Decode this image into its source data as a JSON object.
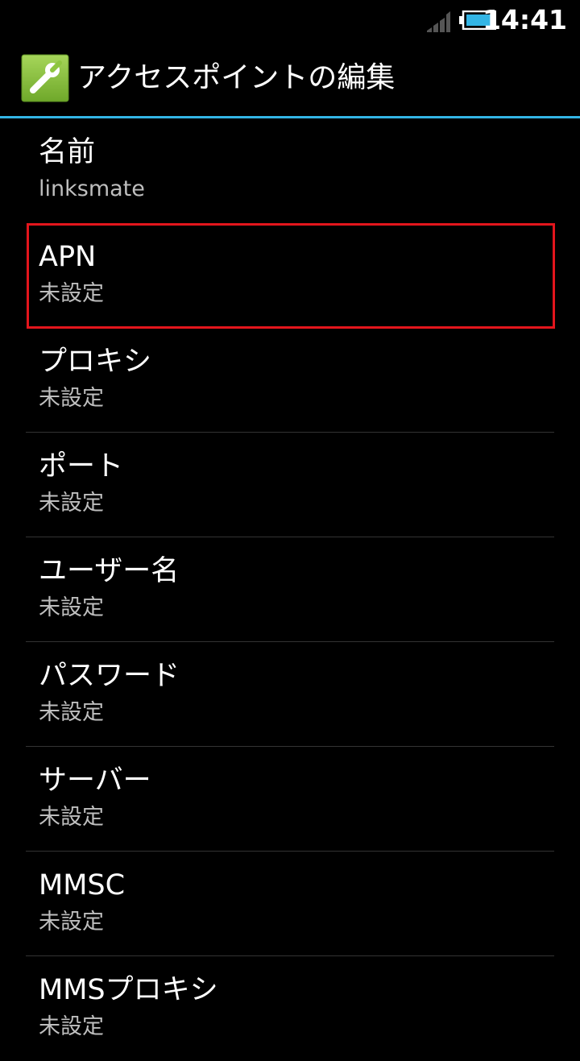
{
  "status_bar": {
    "time": "14:41",
    "signal_icon": "signal-strength-icon",
    "battery_icon": "battery-icon"
  },
  "action_bar": {
    "title": "アクセスポイントの編集",
    "icon": "wrench-icon",
    "icon_color": "#8ec63f",
    "divider_color": "#33b5e5"
  },
  "highlight_color": "#e3151c",
  "preferences": [
    {
      "title": "名前",
      "summary": "linksmate"
    },
    {
      "title": "APN",
      "summary": "未設定"
    },
    {
      "title": "プロキシ",
      "summary": "未設定"
    },
    {
      "title": "ポート",
      "summary": "未設定"
    },
    {
      "title": "ユーザー名",
      "summary": "未設定"
    },
    {
      "title": "パスワード",
      "summary": "未設定"
    },
    {
      "title": "サーバー",
      "summary": "未設定"
    },
    {
      "title": "MMSC",
      "summary": "未設定"
    },
    {
      "title": "MMSプロキシ",
      "summary": "未設定"
    }
  ]
}
